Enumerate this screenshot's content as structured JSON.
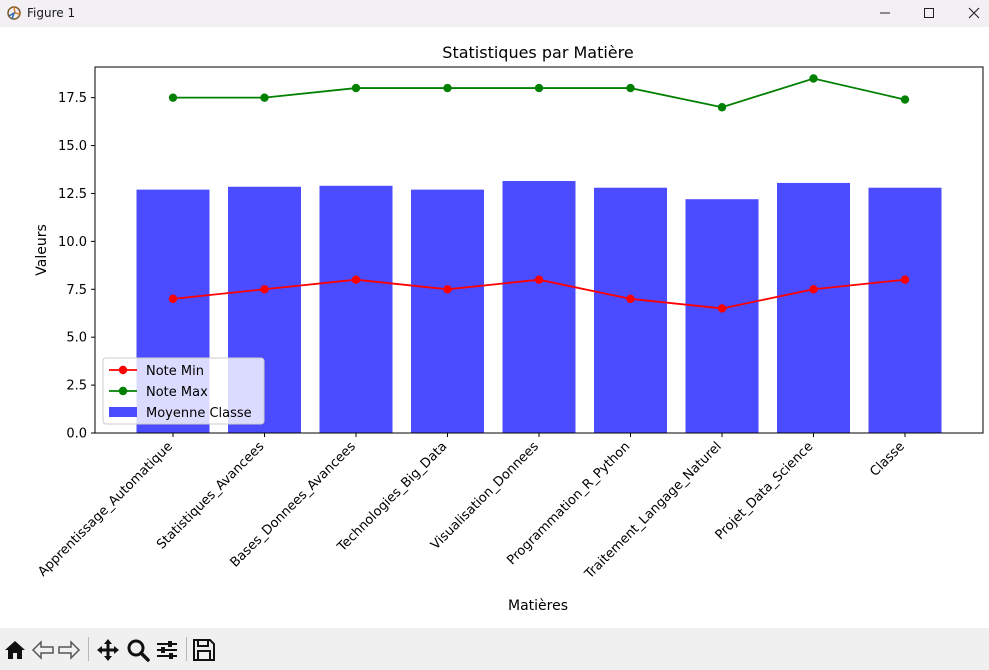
{
  "window": {
    "title": "Figure 1"
  },
  "chart_data": {
    "type": "bar",
    "title": "Statistiques par Matière",
    "xlabel": "Matières",
    "ylabel": "Valeurs",
    "ylim": [
      0,
      19.1
    ],
    "yticks": [
      "0.0",
      "2.5",
      "5.0",
      "7.5",
      "10.0",
      "12.5",
      "15.0",
      "17.5"
    ],
    "categories": [
      "Apprentissage_Automatique",
      "Statistiques_Avancees",
      "Bases_Donnees_Avancees",
      "Technologies_Big_Data",
      "Visualisation_Donnees",
      "Programmation_R_Python",
      "Traitement_Langage_Naturel",
      "Projet_Data_Science",
      "Classe"
    ],
    "series": [
      {
        "name": "Moyenne Classe",
        "kind": "bar",
        "color": "#4b4bff",
        "values": [
          12.7,
          12.85,
          12.9,
          12.7,
          13.15,
          12.8,
          12.2,
          13.05,
          12.8
        ]
      },
      {
        "name": "Note Min",
        "kind": "line",
        "color": "#ff0000",
        "values": [
          7.0,
          7.5,
          8.0,
          7.5,
          8.0,
          7.0,
          6.5,
          7.5,
          8.0
        ]
      },
      {
        "name": "Note Max",
        "kind": "line",
        "color": "#008000",
        "values": [
          17.5,
          17.5,
          18.0,
          18.0,
          18.0,
          18.0,
          17.0,
          18.5,
          17.4
        ]
      }
    ],
    "legend": {
      "position": "lower-left",
      "order": [
        "Note Min",
        "Note Max",
        "Moyenne Classe"
      ]
    },
    "grid": false
  },
  "toolbar": {
    "items": [
      "home-icon",
      "back-icon",
      "forward-icon",
      "pan-icon",
      "zoom-icon",
      "configure-icon",
      "save-icon"
    ]
  }
}
